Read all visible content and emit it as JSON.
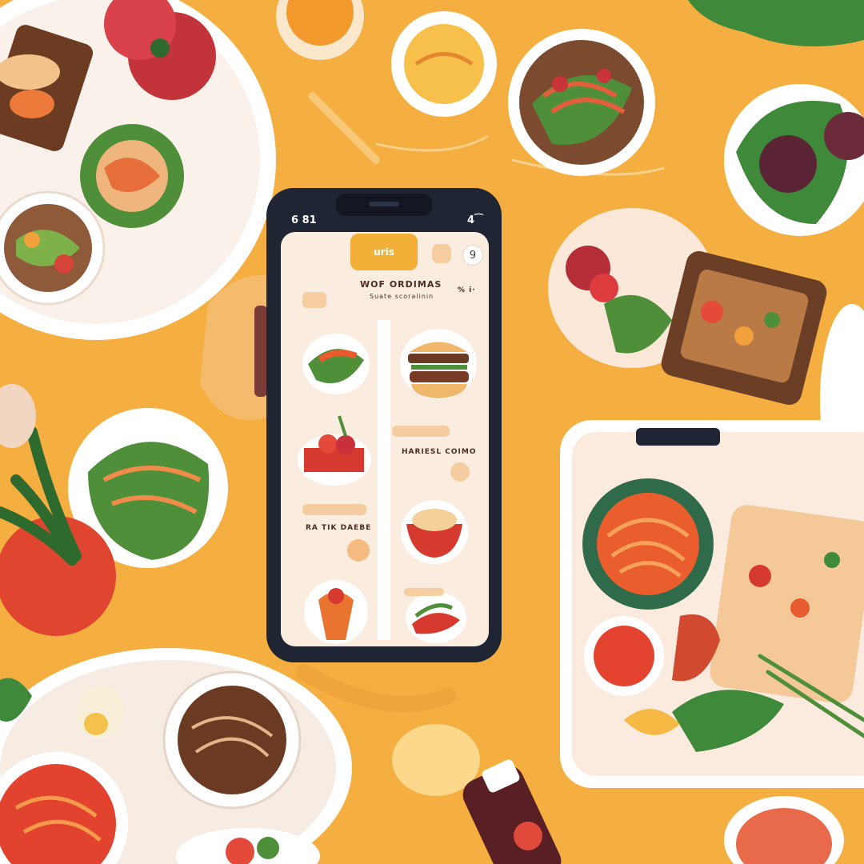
{
  "phone": {
    "status_time": "6 81",
    "status_right": "4⁀",
    "pill_button": "uris",
    "round_button": "9",
    "heading": "WOF ORDIMAS",
    "subheading": "Suate scoralinin",
    "heading_meta": "% i·",
    "card_title_right": "HARIESL COIMO",
    "card_title_left": "RA TIK DAEBE"
  },
  "colors": {
    "background": "#f5ae40",
    "phone_frame": "#1f2533",
    "phone_screen": "#fbece0",
    "accent": "#f2b038"
  }
}
